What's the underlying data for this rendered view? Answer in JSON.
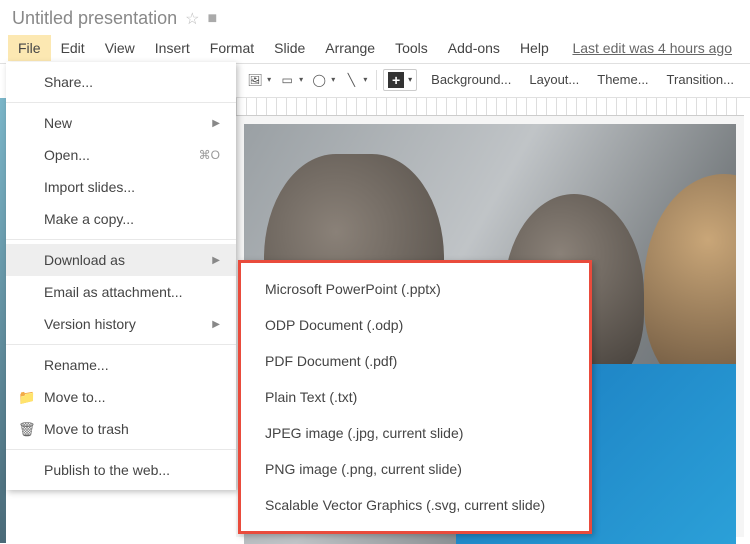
{
  "header": {
    "title": "Untitled presentation"
  },
  "menubar": {
    "items": [
      {
        "label": "File",
        "active": true
      },
      {
        "label": "Edit"
      },
      {
        "label": "View"
      },
      {
        "label": "Insert"
      },
      {
        "label": "Format"
      },
      {
        "label": "Slide"
      },
      {
        "label": "Arrange"
      },
      {
        "label": "Tools"
      },
      {
        "label": "Add-ons"
      },
      {
        "label": "Help"
      }
    ],
    "last_edit": "Last edit was 4 hours ago"
  },
  "toolbar": {
    "background": "Background...",
    "layout": "Layout...",
    "theme": "Theme...",
    "transition": "Transition..."
  },
  "file_menu": {
    "items": [
      {
        "label": "Share...",
        "type": "item"
      },
      {
        "type": "sep"
      },
      {
        "label": "New",
        "type": "sub"
      },
      {
        "label": "Open...",
        "type": "item",
        "shortcut": "⌘O"
      },
      {
        "label": "Import slides...",
        "type": "item"
      },
      {
        "label": "Make a copy...",
        "type": "item"
      },
      {
        "type": "sep"
      },
      {
        "label": "Download as",
        "type": "sub",
        "hover": true
      },
      {
        "label": "Email as attachment...",
        "type": "item"
      },
      {
        "label": "Version history",
        "type": "sub"
      },
      {
        "type": "sep"
      },
      {
        "label": "Rename...",
        "type": "item"
      },
      {
        "label": "Move to...",
        "type": "item",
        "icon": "folder"
      },
      {
        "label": "Move to trash",
        "type": "item",
        "icon": "trash"
      },
      {
        "type": "sep"
      },
      {
        "label": "Publish to the web...",
        "type": "item"
      }
    ]
  },
  "download_submenu": {
    "items": [
      {
        "label": "Microsoft PowerPoint (.pptx)"
      },
      {
        "label": "ODP Document (.odp)"
      },
      {
        "label": "PDF Document (.pdf)"
      },
      {
        "label": "Plain Text (.txt)"
      },
      {
        "label": "JPEG image (.jpg, current slide)"
      },
      {
        "label": "PNG image (.png, current slide)"
      },
      {
        "label": "Scalable Vector Graphics (.svg, current slide)"
      }
    ]
  }
}
